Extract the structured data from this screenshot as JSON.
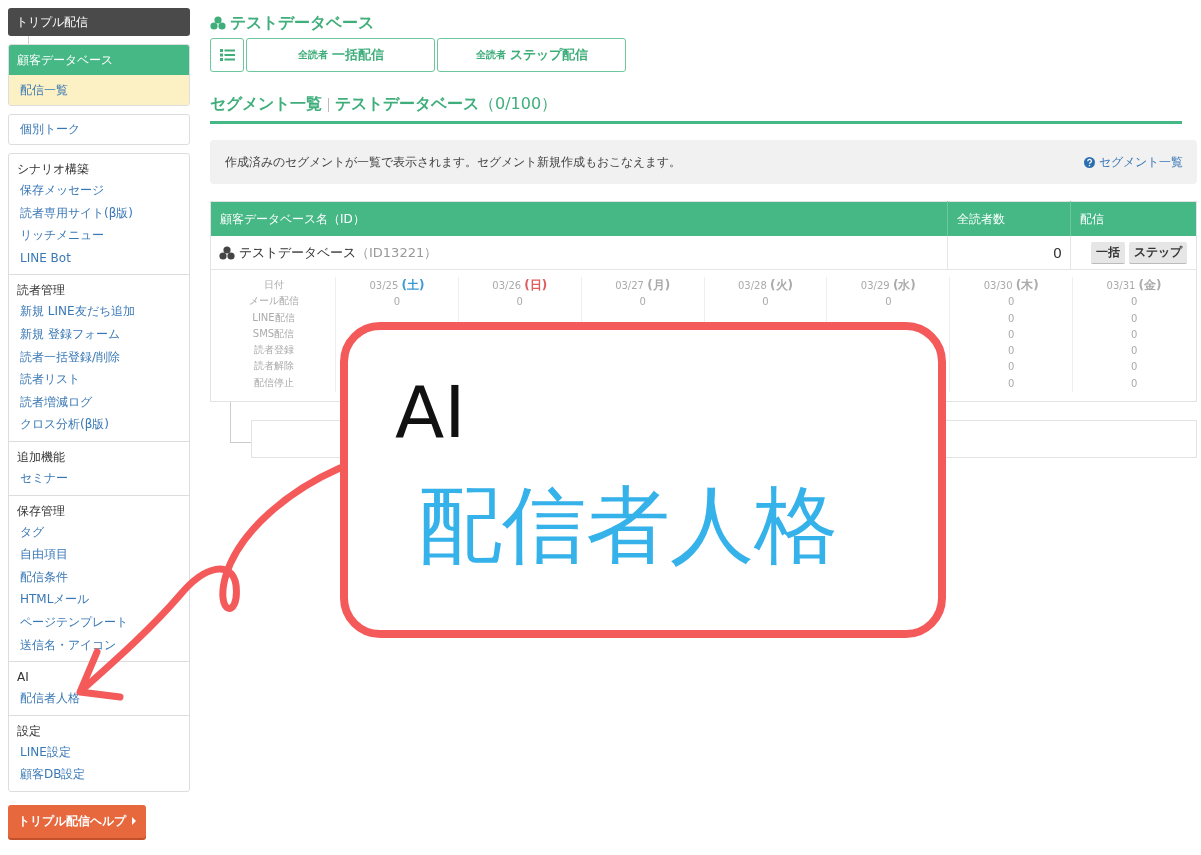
{
  "sidebar": {
    "brand": "トリプル配信",
    "database": {
      "title": "顧客データベース",
      "items": [
        {
          "label": "配信一覧",
          "selected": true
        }
      ]
    },
    "talk": "個別トーク",
    "groups": [
      {
        "heading": "シナリオ構築",
        "items": [
          "保存メッセージ",
          "読者専用サイト(β版)",
          "リッチメニュー",
          "LINE Bot"
        ]
      },
      {
        "heading": "読者管理",
        "items": [
          "新規 LINE友だち追加",
          "新規 登録フォーム",
          "読者一括登録/削除",
          "読者リスト",
          "読者増減ログ",
          "クロス分析(β版)"
        ]
      },
      {
        "heading": "追加機能",
        "items": [
          "セミナー"
        ]
      },
      {
        "heading": "保存管理",
        "items": [
          "タグ",
          "自由項目",
          "配信条件",
          "HTMLメール",
          "ページテンプレート",
          "送信名・アイコン"
        ]
      },
      {
        "heading": "AI",
        "items": [
          "配信者人格"
        ]
      },
      {
        "heading": "設定",
        "items": [
          "LINE設定",
          "顧客DB設定"
        ]
      }
    ],
    "help_button": "トリプル配信ヘルプ"
  },
  "header": {
    "title": "テストデータベース",
    "buttons": [
      {
        "prefix": "全読者",
        "label": "一括配信"
      },
      {
        "prefix": "全読者",
        "label": "ステップ配信"
      }
    ]
  },
  "section": {
    "title": "セグメント一覧",
    "subtitle": "テストデータベース",
    "count": "（0/100）"
  },
  "info": {
    "text": "作成済みのセグメントが一覧で表示されます。セグメント新規作成もおこなえます。",
    "link": "セグメント一覧"
  },
  "table": {
    "columns": [
      "顧客データベース名（ID）",
      "全読者数",
      "配信"
    ],
    "rows": [
      {
        "name": "テストデータベース",
        "id": "（ID13221）",
        "readers": "0",
        "actions": [
          "一括",
          "ステップ"
        ],
        "stats": {
          "labels": [
            "日付",
            "メール配信",
            "LINE配信",
            "SMS配信",
            "読者登録",
            "読者解除",
            "配信停止"
          ],
          "days": [
            {
              "date": "03/25",
              "weekday": "(土)",
              "color": "#3a9ad9",
              "values": [
                "0"
              ]
            },
            {
              "date": "03/26",
              "weekday": "(日)",
              "color": "#e05a5a",
              "values": [
                "0"
              ]
            },
            {
              "date": "03/27",
              "weekday": "(月)",
              "color": "#aaaaaa",
              "values": [
                "0"
              ]
            },
            {
              "date": "03/28",
              "weekday": "(火)",
              "color": "#aaaaaa",
              "values": [
                "0"
              ]
            },
            {
              "date": "03/29",
              "weekday": "(水)",
              "color": "#aaaaaa",
              "values": [
                "0"
              ]
            },
            {
              "date": "03/30",
              "weekday": "(木)",
              "color": "#aaaaaa",
              "values": [
                "0",
                "0",
                "0",
                "0",
                "0",
                "0"
              ]
            },
            {
              "date": "03/31",
              "weekday": "(金)",
              "color": "#aaaaaa",
              "values": [
                "0",
                "0",
                "0",
                "0",
                "0",
                "0"
              ]
            }
          ]
        }
      }
    ]
  },
  "callout": {
    "title": "AI",
    "subtitle": "配信者人格"
  }
}
